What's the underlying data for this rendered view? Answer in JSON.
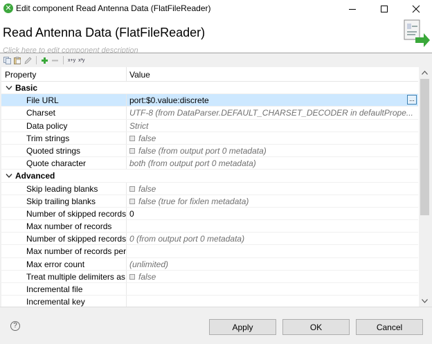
{
  "window": {
    "title": "Edit component Read Antenna Data (FlatFileReader)"
  },
  "header": {
    "component_title": "Read Antenna Data (FlatFileReader)",
    "description_hint": "Click here to edit component description"
  },
  "toolbar": {
    "icons": [
      "copy-icon",
      "paste-icon",
      "edit-icon",
      "add-icon",
      "remove-icon"
    ],
    "text_button_1": "x+y",
    "text_button_2": "x²y"
  },
  "table": {
    "col_property": "Property",
    "col_value": "Value",
    "groups": [
      {
        "label": "Basic",
        "rows": [
          {
            "name": "File URL",
            "value": "port:$0.value:discrete",
            "inherited": false,
            "checkbox": false,
            "selected": true
          },
          {
            "name": "Charset",
            "value": "UTF-8 (from DataParser.DEFAULT_CHARSET_DECODER in defaultPrope...",
            "inherited": true,
            "checkbox": false
          },
          {
            "name": "Data policy",
            "value": "Strict",
            "inherited": true,
            "checkbox": false
          },
          {
            "name": "Trim strings",
            "value": "false",
            "inherited": true,
            "checkbox": true
          },
          {
            "name": "Quoted strings",
            "value": "false (from output port 0 metadata)",
            "inherited": true,
            "checkbox": true
          },
          {
            "name": "Quote character",
            "value": "both (from output port 0 metadata)",
            "inherited": true,
            "checkbox": false
          }
        ]
      },
      {
        "label": "Advanced",
        "rows": [
          {
            "name": "Skip leading blanks",
            "value": "false",
            "inherited": true,
            "checkbox": true
          },
          {
            "name": "Skip trailing blanks",
            "value": "false (true for fixlen metadata)",
            "inherited": true,
            "checkbox": true
          },
          {
            "name": "Number of skipped records",
            "value": "0",
            "inherited": false,
            "checkbox": false
          },
          {
            "name": "Max number of records",
            "value": "",
            "inherited": false,
            "checkbox": false
          },
          {
            "name": "Number of skipped records",
            "value": "0 (from output port 0 metadata)",
            "inherited": true,
            "checkbox": false
          },
          {
            "name": "Max number of records per",
            "value": "",
            "inherited": false,
            "checkbox": false
          },
          {
            "name": "Max error count",
            "value": "(unlimited)",
            "inherited": true,
            "checkbox": false
          },
          {
            "name": "Treat multiple delimiters as c",
            "value": "false",
            "inherited": true,
            "checkbox": true
          },
          {
            "name": "Incremental file",
            "value": "",
            "inherited": false,
            "checkbox": false
          },
          {
            "name": "Incremental key",
            "value": "",
            "inherited": false,
            "checkbox": false
          }
        ]
      }
    ],
    "ellipsis_label": "..."
  },
  "buttons": {
    "apply": "Apply",
    "ok": "OK",
    "cancel": "Cancel",
    "help": "?"
  },
  "colors": {
    "selection": "#cde8ff",
    "inherited_text": "#707070",
    "accent": "#3c7fb1",
    "app_icon": "#3ea83e"
  }
}
